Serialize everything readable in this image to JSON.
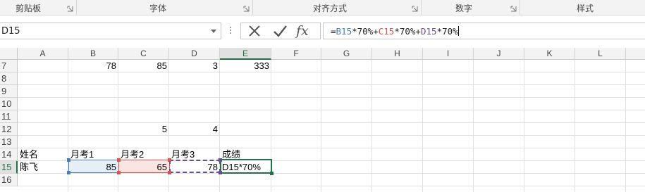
{
  "ribbon": {
    "groups": [
      {
        "label": "剪贴板"
      },
      {
        "label": "字体"
      },
      {
        "label": "对齐方式"
      },
      {
        "label": "数字"
      },
      {
        "label": "样式"
      }
    ]
  },
  "formula_bar": {
    "name_box": "D15",
    "formula_parts": [
      {
        "text": "=",
        "color": "#222222"
      },
      {
        "text": "B15",
        "color": "#4a7ebb"
      },
      {
        "text": "*70%+",
        "color": "#222222"
      },
      {
        "text": "C15",
        "color": "#d9534f"
      },
      {
        "text": "*70%+",
        "color": "#222222"
      },
      {
        "text": "D15",
        "color": "#6a4c93"
      },
      {
        "text": "*70%",
        "color": "#222222"
      }
    ],
    "cancel_icon": "cancel-x-icon",
    "enter_icon": "check-icon",
    "function_icon": "fx-icon",
    "function_label": "fx"
  },
  "grid": {
    "columns": [
      "A",
      "B",
      "C",
      "D",
      "E",
      "F",
      "G",
      "H",
      "I",
      "J",
      "K",
      "L"
    ],
    "selected_column": "E",
    "rows": [
      "7",
      "8",
      "9",
      "10",
      "11",
      "12",
      "13",
      "14",
      "15",
      "16"
    ],
    "selected_row": "15",
    "cells": {
      "B7": "78",
      "C7": "85",
      "D7": "3",
      "E7": "333",
      "C12": "5",
      "D12": "4",
      "A14": "姓名",
      "B14": "月考1",
      "C14": "月考2",
      "D14": "月考3",
      "E14": "成绩",
      "A15": "陈飞",
      "B15": "85",
      "C15": "65",
      "D15": "78",
      "E15": "D15*70%"
    }
  },
  "colors": {
    "accent": "#217346",
    "ref_b": "#4a7ebb",
    "ref_c": "#d9534f",
    "ref_d": "#6a4c93"
  }
}
